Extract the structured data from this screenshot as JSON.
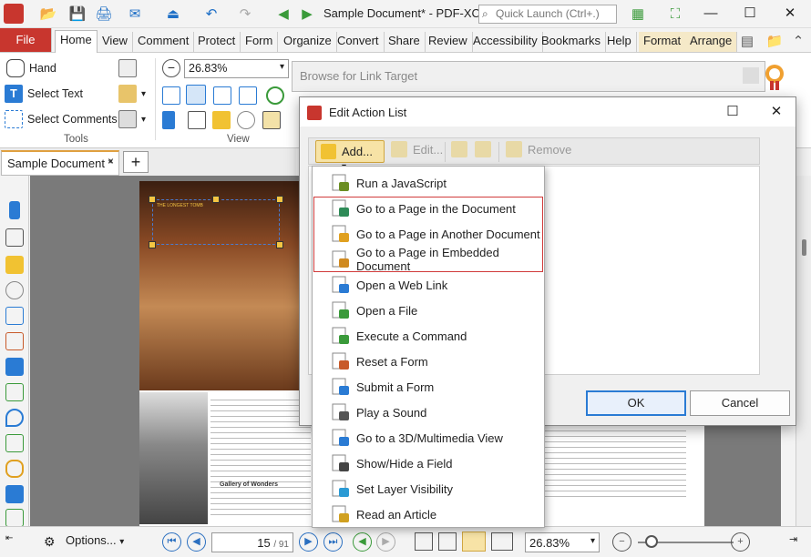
{
  "app": {
    "title": "Sample Document* - PDF-XCh...",
    "quick_launch_placeholder": "Quick Launch (Ctrl+.)"
  },
  "window_controls": {
    "minimize": "—",
    "maximize": "☐",
    "close": "✕"
  },
  "ribbon_tabs": [
    "File",
    "Home",
    "View",
    "Comment",
    "Protect",
    "Form",
    "Organize",
    "Convert",
    "Share",
    "Review",
    "Accessibility",
    "Bookmarks",
    "Help",
    "Format",
    "Arrange"
  ],
  "active_tab": "Home",
  "ribbon": {
    "tools": {
      "hand": "Hand",
      "select_text": "Select Text",
      "select_comments": "Select Comments",
      "group_label": "Tools"
    },
    "view": {
      "zoom_value": "26.83%",
      "group_label": "View"
    }
  },
  "document_tab": {
    "label": "Sample Document *",
    "close": "×",
    "new_tab": "+"
  },
  "page_content": {
    "heading": "THE LONGEST TOMB",
    "subheading": "Gallery of Wonders"
  },
  "background_dialog": {
    "title": "Browse for Link Target"
  },
  "dialog": {
    "title": "Edit Action List",
    "toolbar": {
      "add": "Add...",
      "edit": "Edit...",
      "remove": "Remove"
    },
    "ok": "OK",
    "cancel": "Cancel"
  },
  "menu_items": [
    {
      "label": "Run a JavaScript",
      "icon": "javascript-icon",
      "color": "#6b8e23"
    },
    {
      "label": "Go to a Page in the Document",
      "icon": "goto-page-icon",
      "color": "#2e8b57"
    },
    {
      "label": "Go to a Page in Another Document",
      "icon": "goto-other-doc-icon",
      "color": "#e0a020"
    },
    {
      "label": "Go to a Page in Embedded Document",
      "icon": "goto-embedded-doc-icon",
      "color": "#d08a20"
    },
    {
      "label": "Open a Web Link",
      "icon": "web-link-icon",
      "color": "#2a7bd4"
    },
    {
      "label": "Open a File",
      "icon": "open-file-icon",
      "color": "#3a9a3a"
    },
    {
      "label": "Execute a Command",
      "icon": "execute-command-icon",
      "color": "#3a9a3a"
    },
    {
      "label": "Reset a Form",
      "icon": "reset-form-icon",
      "color": "#c85a2a"
    },
    {
      "label": "Submit a Form",
      "icon": "submit-form-icon",
      "color": "#2a7bd4"
    },
    {
      "label": "Play a Sound",
      "icon": "sound-icon",
      "color": "#555555"
    },
    {
      "label": "Go to a 3D/Multimedia View",
      "icon": "3d-view-icon",
      "color": "#2a7bd4"
    },
    {
      "label": "Show/Hide a Field",
      "icon": "show-hide-field-icon",
      "color": "#444444"
    },
    {
      "label": "Set Layer Visibility",
      "icon": "layer-visibility-icon",
      "color": "#2a9ad4"
    },
    {
      "label": "Read an Article",
      "icon": "read-article-icon",
      "color": "#d0a020"
    }
  ],
  "statusbar": {
    "options": "Options...",
    "page_current": "15",
    "page_total": "/ 91",
    "zoom": "26.83%"
  },
  "colors": {
    "accent": "#c8362e",
    "highlight_border": "#d03a3a",
    "ok_border": "#2a7bd4"
  }
}
